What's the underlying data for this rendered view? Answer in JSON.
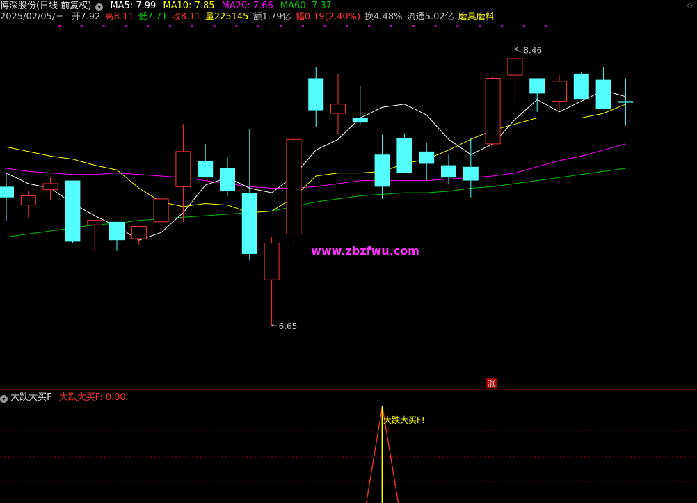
{
  "header": {
    "stock_name": "博深股份",
    "period": "(日线 前复权)",
    "ma5_label": "MA5: 7.99",
    "ma10_label": "MA10: 7.85",
    "ma20_label": "MA20: 7.66",
    "ma60_label": "MA60: 7.37",
    "date": "2025/02/05/三",
    "open": "开7.92",
    "high": "高8.11",
    "low": "低7.71",
    "close": "收8.11",
    "volume": "量225145",
    "amount": "额1.79亿",
    "change": "幅0.19(2.40%)",
    "turnover": "换4.48%",
    "float_cap": "流通5.02亿",
    "concept": "磨具磨料"
  },
  "colors": {
    "up": "#ff3232",
    "down": "#54ffff",
    "ma5": "#ffffff",
    "ma10": "#ffff00",
    "ma20": "#ff00ff",
    "ma60": "#00c000",
    "grid": "#8b0000",
    "text": "#c0c0c0"
  },
  "watermark": "www.zbzfwu.com",
  "zhang_marker": "涨",
  "indicator": {
    "name": "大跌大买F",
    "value_label": "大跌大买F: 0.00",
    "signal_label": "大跌大买F!"
  },
  "chart_data": {
    "type": "candlestick",
    "y_scale": {
      "min": 6.3,
      "max": 8.6
    },
    "annotations": {
      "high": 8.46,
      "low": 6.65
    },
    "candles": [
      {
        "o": 7.56,
        "h": 7.65,
        "l": 7.34,
        "c": 7.49
      },
      {
        "o": 7.44,
        "h": 7.53,
        "l": 7.36,
        "c": 7.5
      },
      {
        "o": 7.54,
        "h": 7.62,
        "l": 7.47,
        "c": 7.58
      },
      {
        "o": 7.6,
        "h": 7.6,
        "l": 7.19,
        "c": 7.2
      },
      {
        "o": 7.31,
        "h": 7.34,
        "l": 7.14,
        "c": 7.34
      },
      {
        "o": 7.33,
        "h": 7.33,
        "l": 7.14,
        "c": 7.21
      },
      {
        "o": 7.22,
        "h": 7.3,
        "l": 7.18,
        "c": 7.3
      },
      {
        "o": 7.33,
        "h": 7.44,
        "l": 7.22,
        "c": 7.48
      },
      {
        "o": 7.56,
        "h": 7.97,
        "l": 7.33,
        "c": 7.79
      },
      {
        "o": 7.73,
        "h": 7.84,
        "l": 7.64,
        "c": 7.62
      },
      {
        "o": 7.68,
        "h": 7.75,
        "l": 7.5,
        "c": 7.53
      },
      {
        "o": 7.52,
        "h": 7.94,
        "l": 7.08,
        "c": 7.12
      },
      {
        "o": 6.95,
        "h": 7.23,
        "l": 6.65,
        "c": 7.19
      },
      {
        "o": 7.25,
        "h": 7.9,
        "l": 7.18,
        "c": 7.87
      },
      {
        "o": 8.27,
        "h": 8.34,
        "l": 7.95,
        "c": 8.06
      },
      {
        "o": 8.04,
        "h": 8.3,
        "l": 7.9,
        "c": 8.1
      },
      {
        "o": 8.01,
        "h": 8.22,
        "l": 7.96,
        "c": 7.98
      },
      {
        "o": 7.77,
        "h": 7.9,
        "l": 7.48,
        "c": 7.56
      },
      {
        "o": 7.88,
        "h": 7.91,
        "l": 7.67,
        "c": 7.65
      },
      {
        "o": 7.79,
        "h": 7.85,
        "l": 7.6,
        "c": 7.71
      },
      {
        "o": 7.7,
        "h": 7.77,
        "l": 7.58,
        "c": 7.62
      },
      {
        "o": 7.69,
        "h": 7.88,
        "l": 7.49,
        "c": 7.6
      },
      {
        "o": 7.84,
        "h": 8.28,
        "l": 7.83,
        "c": 8.27
      },
      {
        "o": 8.29,
        "h": 8.46,
        "l": 8.12,
        "c": 8.4
      },
      {
        "o": 8.27,
        "h": 8.27,
        "l": 8.05,
        "c": 8.17
      },
      {
        "o": 8.12,
        "h": 8.29,
        "l": 8.06,
        "c": 8.25
      },
      {
        "o": 8.3,
        "h": 8.31,
        "l": 8.15,
        "c": 8.13
      },
      {
        "o": 8.26,
        "h": 8.34,
        "l": 8.09,
        "c": 8.07
      },
      {
        "o": 8.12,
        "h": 8.27,
        "l": 7.96,
        "c": 8.11
      }
    ],
    "ma5": [
      7.65,
      7.58,
      7.55,
      7.45,
      7.37,
      7.3,
      7.21,
      7.26,
      7.39,
      7.57,
      7.62,
      7.55,
      7.52,
      7.63,
      7.8,
      7.87,
      8.01,
      8.08,
      8.1,
      8.03,
      7.87,
      7.77,
      7.84,
      8.0,
      8.13,
      8.05,
      8.12,
      8.19,
      8.15
    ],
    "ma10": [
      7.82,
      7.79,
      7.76,
      7.74,
      7.7,
      7.67,
      7.55,
      7.46,
      7.43,
      7.45,
      7.44,
      7.39,
      7.4,
      7.49,
      7.63,
      7.65,
      7.65,
      7.66,
      7.71,
      7.74,
      7.8,
      7.87,
      7.93,
      7.97,
      8.01,
      8.01,
      8.01,
      8.04,
      8.1
    ],
    "ma20": [
      7.68,
      7.66,
      7.65,
      7.64,
      7.64,
      7.65,
      7.64,
      7.63,
      7.62,
      7.6,
      7.58,
      7.56,
      7.55,
      7.55,
      7.56,
      7.58,
      7.6,
      7.6,
      7.6,
      7.6,
      7.61,
      7.62,
      7.63,
      7.65,
      7.69,
      7.73,
      7.76,
      7.8,
      7.84
    ],
    "ma60": [
      7.23,
      7.25,
      7.27,
      7.29,
      7.31,
      7.32,
      7.34,
      7.35,
      7.36,
      7.37,
      7.38,
      7.39,
      7.4,
      7.43,
      7.46,
      7.48,
      7.5,
      7.51,
      7.52,
      7.52,
      7.53,
      7.55,
      7.56,
      7.58,
      7.6,
      7.62,
      7.64,
      7.66,
      7.68
    ],
    "signal": [
      0,
      0,
      0,
      0,
      0,
      0,
      0,
      0,
      0,
      0,
      0,
      0,
      0,
      0,
      0,
      0,
      0,
      1,
      0,
      0,
      0,
      0,
      0,
      0,
      0,
      0,
      0,
      0,
      0
    ]
  }
}
